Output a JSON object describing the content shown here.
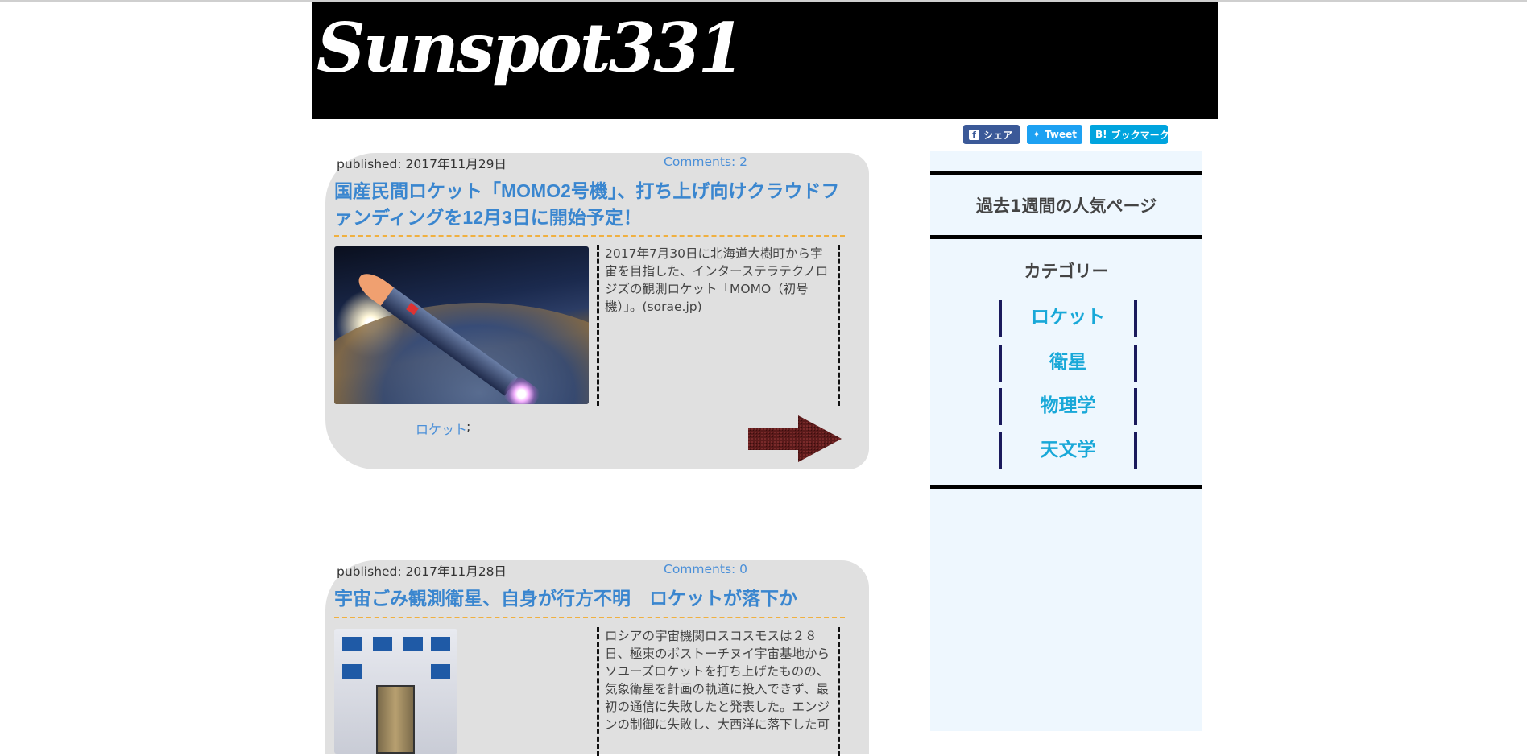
{
  "header": {
    "logo_text": "Sunspot331"
  },
  "share_buttons": [
    {
      "label": "シェア",
      "icon": "facebook-icon",
      "color": "#3b5998"
    },
    {
      "label": "Tweet",
      "icon": "twitter-icon",
      "color": "#1da1f2"
    },
    {
      "label": "ブックマーク",
      "icon_text": "B!",
      "icon": "hatena-bookmark-icon",
      "color": "#00a4de"
    }
  ],
  "articles": [
    {
      "published": "published: 2017年11月29日",
      "comments": "Comments: 2",
      "title": "国産民間ロケット「MOMO2号機」、打ち上げ向けクラウドファンディングを12月3日に開始予定！",
      "summary": "2017年7月30日に北海道大樹町から宇宙を目指した、インターステラテクノロジズの観測ロケット「MOMO（初号機）」。(sorae.jp)",
      "category": "ロケット",
      "category_separator": ";"
    },
    {
      "published": "published: 2017年11月28日",
      "comments": "Comments: 0",
      "title": "宇宙ごみ観測衛星、自身が行方不明　ロケットが落下か",
      "summary": "ロシアの宇宙機関ロスコスモスは２８日、極東のボストーチヌイ宇宙基地からソユーズロケットを打ち上げたものの、気象衛星を計画の軌道に投入できず、最初の通信に失敗したと発表した。エンジンの制御に失敗し、大西洋に落下した可"
    }
  ],
  "sidebar": {
    "popular_title": "過去1週間の人気ページ",
    "category_title": "カテゴリー",
    "categories": [
      "ロケット",
      "衛星",
      "物理学",
      "天文学"
    ]
  },
  "colors": {
    "link": "#4a8fd8",
    "title": "#3a86cf",
    "category": "#18a8d8",
    "article_bg": "#e0e0e0",
    "sidebar_bg": "#eef7fe",
    "dashed_rule": "#f0b040"
  }
}
